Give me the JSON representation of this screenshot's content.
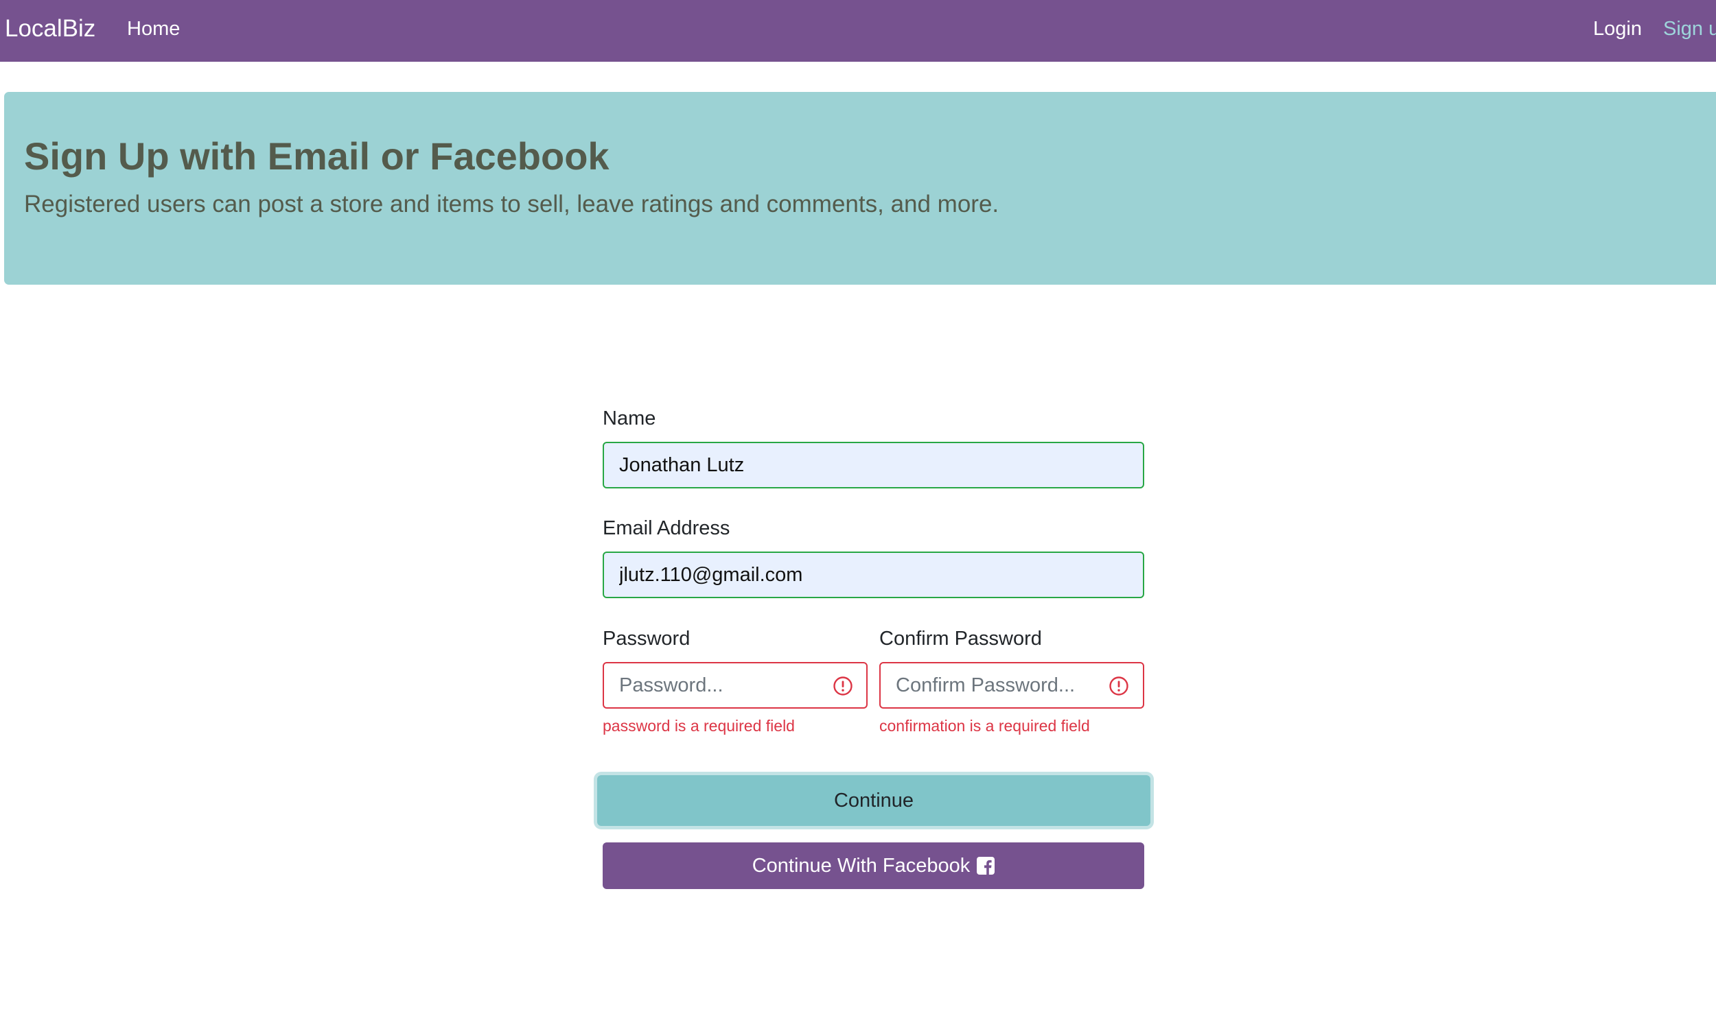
{
  "navbar": {
    "brand": "LocalBiz",
    "home_label": "Home",
    "login_label": "Login",
    "signup_label": "Sign up"
  },
  "jumbotron": {
    "title": "Sign Up with Email or Facebook",
    "lead": "Registered users can post a store and items to sell, leave ratings and comments, and more."
  },
  "form": {
    "name": {
      "label": "Name",
      "value": "Jonathan Lutz",
      "state": "valid"
    },
    "email": {
      "label": "Email Address",
      "value": "jlutz.110@gmail.com",
      "state": "valid"
    },
    "password": {
      "label": "Password",
      "placeholder": "Password...",
      "error": "password is a required field",
      "state": "invalid",
      "icon": "exclamation-circle-icon"
    },
    "confirm_password": {
      "label": "Confirm Password",
      "placeholder": "Confirm Password...",
      "error": "confirmation is a required field",
      "state": "invalid",
      "icon": "exclamation-circle-icon"
    },
    "continue_label": "Continue",
    "facebook_label": "Continue With Facebook",
    "facebook_icon": "facebook-square-icon"
  },
  "colors": {
    "navbar_bg": "#76528f",
    "signup_link": "#9ed5db",
    "jumbotron_bg": "#9cd2d4",
    "heading_text": "#545b4c",
    "valid_border": "#28a745",
    "invalid_border": "#dc3545",
    "autofill_bg": "#e8f0fe",
    "continue_bg": "#80c5c9",
    "facebook_bg": "#76528f"
  }
}
